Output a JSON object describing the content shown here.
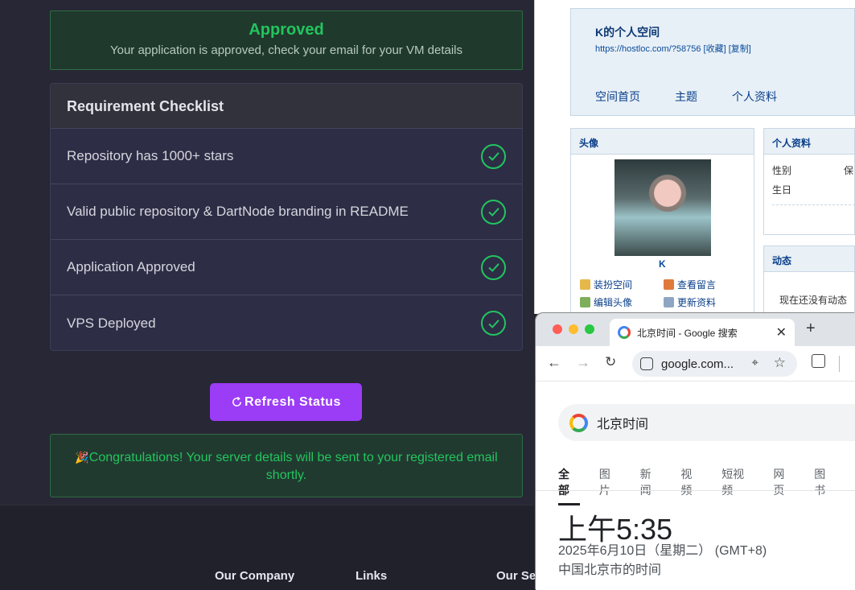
{
  "left": {
    "approved_title": "Approved",
    "approved_message": "Your application is approved, check your email for your VM details",
    "checklist_title": "Requirement Checklist",
    "checklist_items": [
      {
        "label": "Repository has 1000+ stars",
        "checked": true
      },
      {
        "label": "Valid public repository & DartNode branding in README",
        "checked": true
      },
      {
        "label": "Application Approved",
        "checked": true
      },
      {
        "label": "VPS Deployed",
        "checked": true
      }
    ],
    "refresh_label": "Refresh Status",
    "congrats_message": "Congratulations! Your server details will be sent to your registered email shortly.",
    "footer": {
      "col1": "Our Company",
      "col2": "Links",
      "col3": "Our Se"
    },
    "colors": {
      "accent": "#9b3cf6",
      "success": "#22c55e"
    }
  },
  "hostloc": {
    "name": "K的个人空间",
    "url": "https://hostloc.com/?58756 [收藏] [复制]",
    "nav": [
      "空间首页",
      "主题",
      "个人资料"
    ],
    "avatar_panel_title": "头像",
    "avatar_name": "K",
    "links": [
      "装扮空间",
      "查看留言",
      "编辑头像",
      "更新资料"
    ],
    "profile_panel_title": "个人资料",
    "profile_fields": [
      {
        "label": "性别",
        "value": "保"
      },
      {
        "label": "生日",
        "value": ""
      }
    ],
    "feed_panel_title": "动态",
    "feed_empty": "现在还没有动态"
  },
  "chrome": {
    "tab_title": "北京时间 - Google 搜索",
    "omnibox_text": "google.com...",
    "search_query": "北京时间",
    "search_tabs": [
      "全部",
      "图片",
      "新闻",
      "视频",
      "短视频",
      "网页",
      "图书"
    ],
    "active_tab": "全部",
    "time": "上午5:35",
    "date": "2025年6月10日（星期二）  (GMT+8)",
    "location": "中国北京市的时间"
  }
}
